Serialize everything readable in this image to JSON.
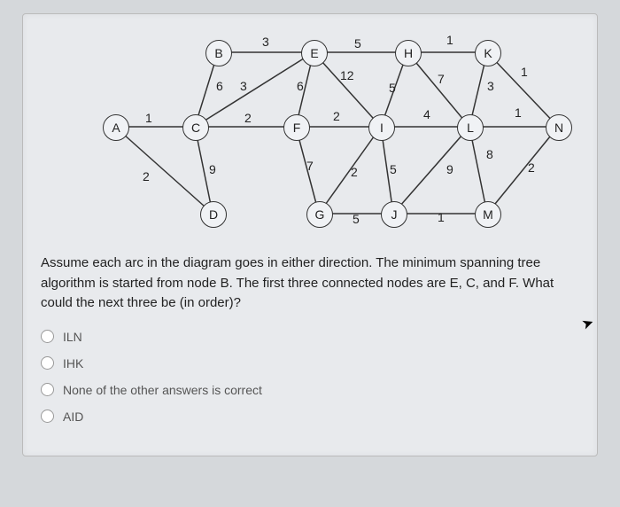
{
  "diagram": {
    "nodes": {
      "A": "A",
      "B": "B",
      "C": "C",
      "D": "D",
      "E": "E",
      "F": "F",
      "G": "G",
      "H": "H",
      "I": "I",
      "J": "J",
      "K": "K",
      "L": "L",
      "M": "M",
      "N": "N"
    },
    "edges": {
      "AC": "1",
      "AD2": "2",
      "BC": "6",
      "BE": "3",
      "CD": "9",
      "CE3": "3",
      "CF": "2",
      "EF": "6",
      "EH": "5",
      "EI12": "12",
      "FI": "2",
      "FG": "7",
      "GJ": "5",
      "GI2": "2",
      "HI": "5",
      "HK": "1",
      "HL7": "7",
      "IJ": "5",
      "IL": "4",
      "JM": "1",
      "KL": "3",
      "KN": "1",
      "LM": "9",
      "LM8": "8",
      "LN": "1",
      "MN": "2"
    }
  },
  "question": "Assume each arc in the diagram goes in either direction.  The minimum spanning tree algorithm is started from node B. The first three connected nodes are E, C, and F. What could the next three be (in order)?",
  "options": [
    "ILN",
    "IHK",
    "None of the other answers is correct",
    "AID"
  ]
}
